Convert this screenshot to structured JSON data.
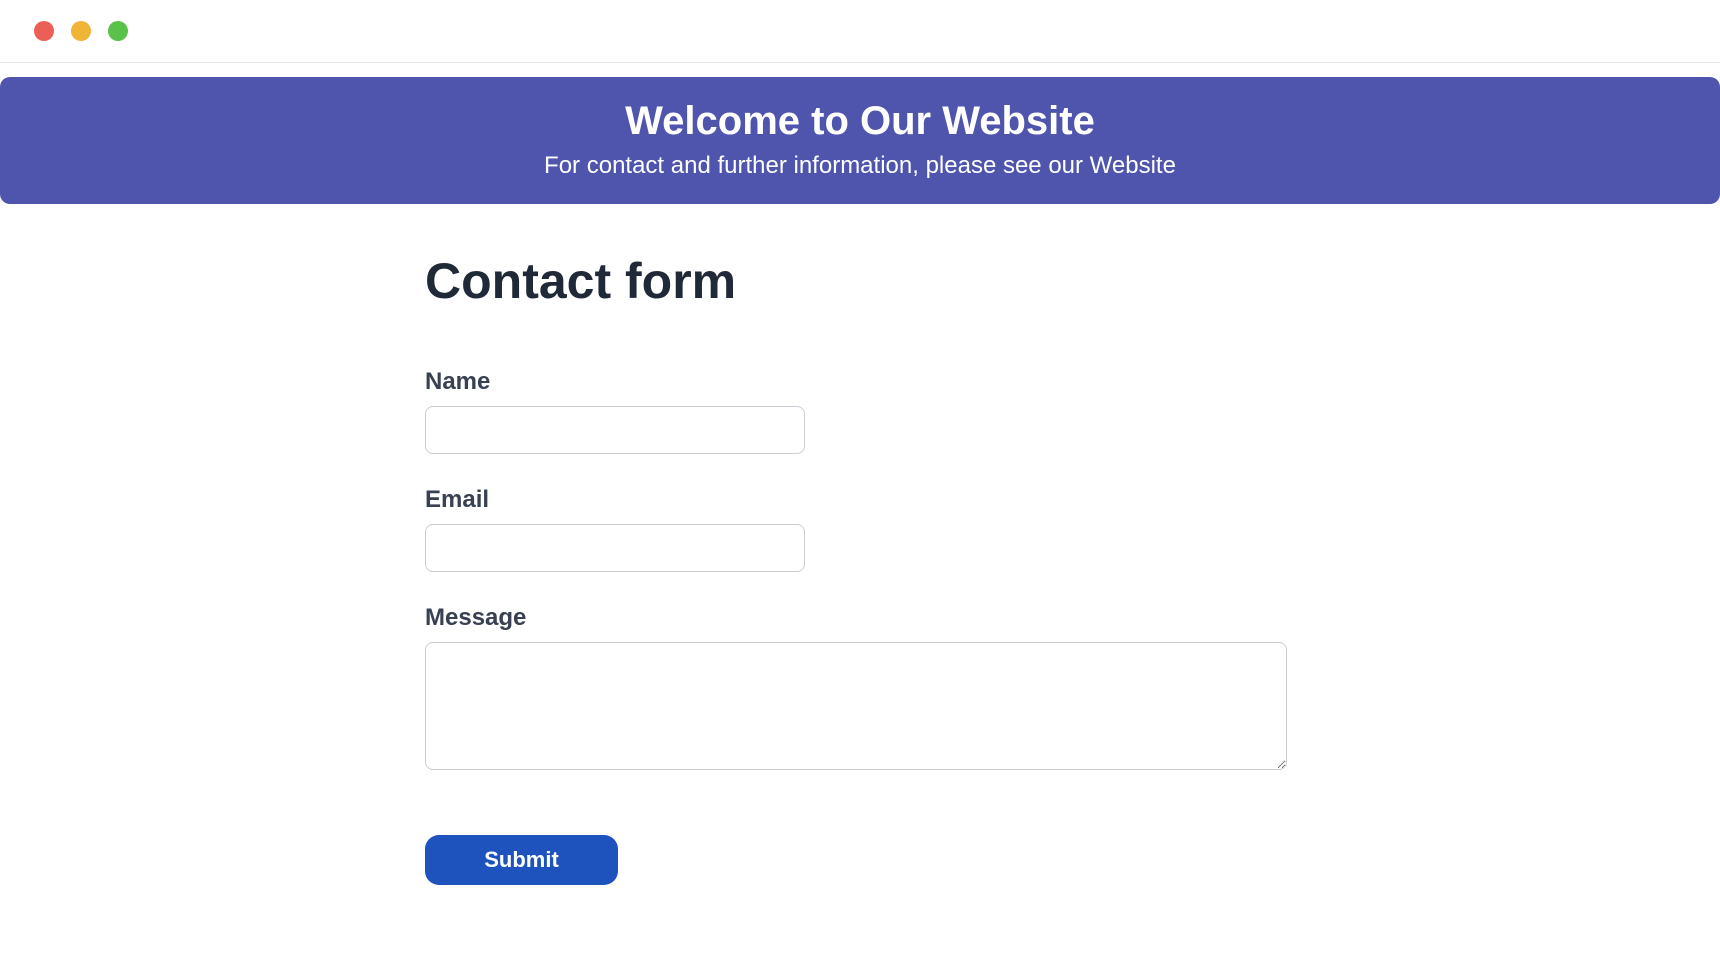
{
  "banner": {
    "title": "Welcome to Our Website",
    "subtitle": "For contact and further information, please see our Website"
  },
  "form": {
    "heading": "Contact form",
    "fields": {
      "name": {
        "label": "Name",
        "value": ""
      },
      "email": {
        "label": "Email",
        "value": ""
      },
      "message": {
        "label": "Message",
        "value": ""
      }
    },
    "submit_label": "Submit"
  }
}
